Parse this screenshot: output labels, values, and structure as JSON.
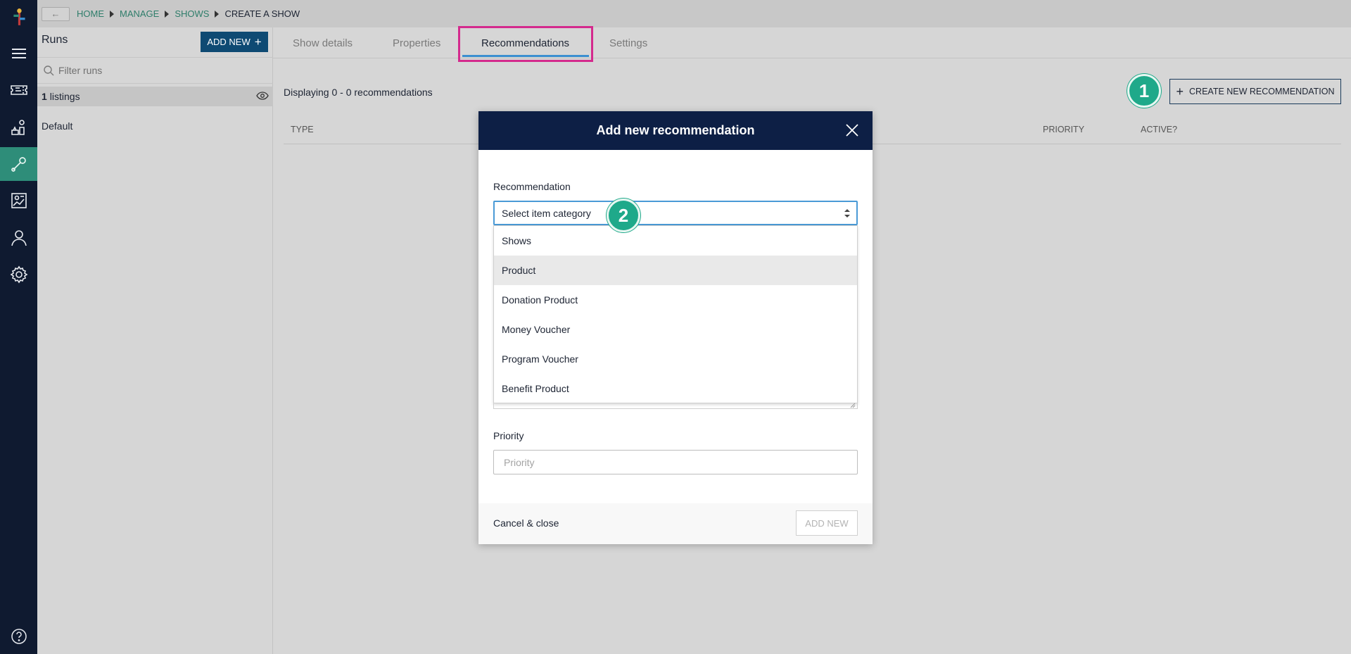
{
  "rail": {
    "items": [
      {
        "icon": "ticket-icon"
      },
      {
        "icon": "products-icon"
      },
      {
        "icon": "wrench-icon",
        "active": true
      },
      {
        "icon": "reports-icon"
      },
      {
        "icon": "user-icon"
      },
      {
        "icon": "gear-icon"
      }
    ],
    "help_icon": "help-icon"
  },
  "topbar": {
    "back_label": "←",
    "breadcrumb": [
      "HOME",
      "MANAGE",
      "SHOWS",
      "CREATE A SHOW"
    ]
  },
  "runs": {
    "title": "Runs",
    "add_new_label": "ADD NEW",
    "add_new_icon": "+",
    "filter_placeholder": "Filter runs",
    "listings_count": "1",
    "listings_label": "listings",
    "items": [
      "Default"
    ]
  },
  "tabs": [
    {
      "label": "Show details"
    },
    {
      "label": "Properties"
    },
    {
      "label": "Recommendations",
      "active": true
    },
    {
      "label": "Settings"
    }
  ],
  "content": {
    "display_text": "Displaying 0 - 0 recommendations",
    "create_label": "CREATE NEW RECOMMENDATION",
    "create_icon": "+",
    "columns": [
      "TYPE",
      "PRIORITY",
      "ACTIVE?"
    ]
  },
  "badges": [
    "1",
    "2"
  ],
  "modal": {
    "title": "Add new recommendation",
    "recommendation_label": "Recommendation",
    "select_value": "Select item category",
    "options": [
      "Shows",
      "Product",
      "Donation Product",
      "Money Voucher",
      "Program Voucher",
      "Benefit Product"
    ],
    "highlighted_option": "Product",
    "priority_label": "Priority",
    "priority_placeholder": "Priority",
    "cancel_label": "Cancel & close",
    "add_label": "ADD NEW"
  },
  "colors": {
    "rail_bg": "#0f1a30",
    "rail_active": "#2e8d79",
    "primary_button": "#0e4a73",
    "modal_header": "#0d1f45",
    "badge": "#1fa98a",
    "tab_highlight": "#d42a8d",
    "tab_underline": "#3b8fd0"
  }
}
